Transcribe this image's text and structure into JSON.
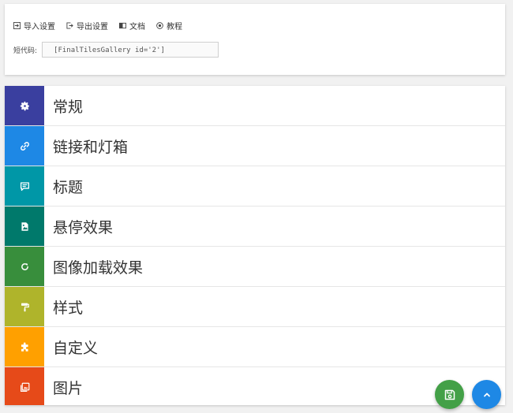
{
  "toolbar": {
    "import_label": "导入设置",
    "export_label": "导出设置",
    "docs_label": "文档",
    "tutorial_label": "教程"
  },
  "shortcode": {
    "label": "短代码:",
    "value": "[FinalTilesGallery id='2']"
  },
  "menu": {
    "items": [
      {
        "label": "常规",
        "icon": "gear-icon",
        "color": "#3a3f9f"
      },
      {
        "label": "链接和灯箱",
        "icon": "link-icon",
        "color": "#1e88e5"
      },
      {
        "label": "标题",
        "icon": "caption-icon",
        "color": "#0097a7"
      },
      {
        "label": "悬停效果",
        "icon": "image-effect-icon",
        "color": "#00796b"
      },
      {
        "label": "图像加载效果",
        "icon": "refresh-icon",
        "color": "#388e3c"
      },
      {
        "label": "样式",
        "icon": "paint-roller-icon",
        "color": "#afb42b"
      },
      {
        "label": "自定义",
        "icon": "puzzle-icon",
        "color": "#ffa000"
      },
      {
        "label": "图片",
        "icon": "images-icon",
        "color": "#e64a19"
      }
    ]
  },
  "fabs": {
    "save_color": "#43a047",
    "top_color": "#1e88e5"
  }
}
